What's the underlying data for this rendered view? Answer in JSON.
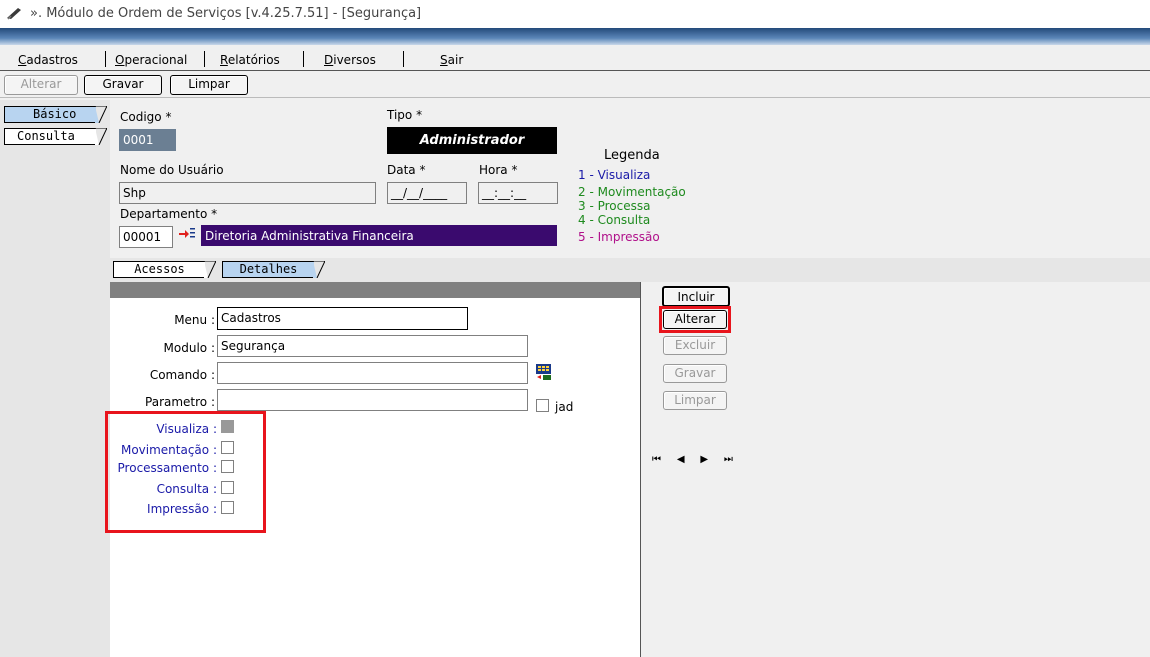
{
  "window": {
    "title": "». Módulo de Ordem de Serviços [v.4.25.7.51] - [Segurança]"
  },
  "menubar": {
    "items": [
      "Cadastros",
      "Operacional",
      "Relatórios",
      "Diversos",
      "Sair"
    ]
  },
  "toolbar": {
    "alterar": "Alterar",
    "gravar": "Gravar",
    "limpar": "Limpar"
  },
  "sidebar": {
    "tabs": [
      "Básico",
      "Consulta"
    ]
  },
  "form": {
    "codigo_label": "Codigo *",
    "codigo_value": "0001",
    "tipo_label": "Tipo *",
    "tipo_value": "Administrador",
    "nome_label": "Nome do Usuário",
    "nome_value": "Shp",
    "data_label": "Data *",
    "data_value": "__/__/____",
    "hora_label": "Hora *",
    "hora_value": "__:__:__",
    "departamento_label": "Departamento *",
    "departamento_code": "00001",
    "departamento_name": "Diretoria Administrativa Financeira"
  },
  "legend": {
    "title": "Legenda",
    "items": [
      {
        "text": "1 - Visualiza",
        "color": "#1a1aa8"
      },
      {
        "text": "2 - Movimentação",
        "color": "#1e8a1e"
      },
      {
        "text": "3 - Processa",
        "color": "#1e8a1e"
      },
      {
        "text": "4 - Consulta",
        "color": "#1e8a1e"
      },
      {
        "text": "5 - Impressão",
        "color": "#b0108a"
      }
    ]
  },
  "detail_tabs": [
    "Acessos",
    "Detalhes"
  ],
  "detail": {
    "menu_label": "Menu :",
    "menu_value": "Cadastros",
    "modulo_label": "Modulo :",
    "modulo_value": "Segurança",
    "comando_label": "Comando :",
    "comando_value": "",
    "parametro_label": "Parametro :",
    "parametro_value": "",
    "jad_label": "jad",
    "permissions": [
      {
        "label": "Visualiza :",
        "checked": true
      },
      {
        "label": "Movimentação :",
        "checked": false
      },
      {
        "label": "Processamento :",
        "checked": false
      },
      {
        "label": "Consulta :",
        "checked": false
      },
      {
        "label": "Impressão :",
        "checked": false
      }
    ]
  },
  "actions": {
    "incluir": "Incluir",
    "alterar": "Alterar",
    "excluir": "Excluir",
    "gravar": "Gravar",
    "limpar": "Limpar"
  },
  "colors": {
    "accent_red": "#e8141c",
    "department_bg": "#3a0a6e",
    "codigo_bg": "#6b7f93",
    "active_tab": "#b8d4f0"
  }
}
